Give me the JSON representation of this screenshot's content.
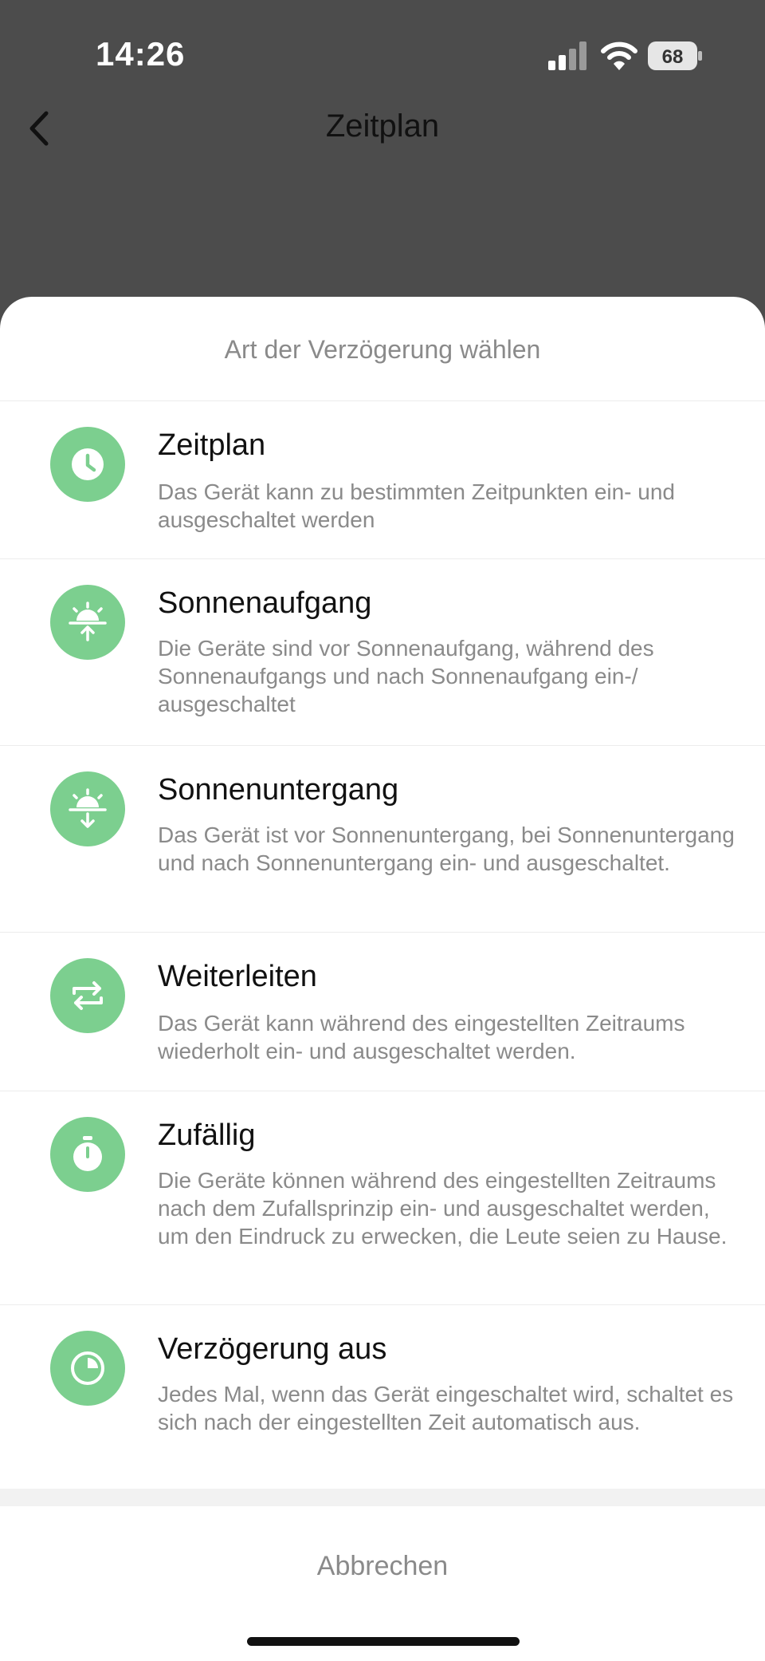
{
  "status": {
    "time": "14:26",
    "battery": "68"
  },
  "nav": {
    "title": "Zeitplan"
  },
  "sheet": {
    "title": "Art der Verzögerung wählen",
    "options": [
      {
        "icon": "clock-icon",
        "title": "Zeitplan",
        "desc": "Das Gerät kann zu bestimmten Zeitpunkten ein- und ausgeschaltet werden"
      },
      {
        "icon": "sunrise-icon",
        "title": "Sonnenaufgang",
        "desc": "Die Geräte sind vor Sonnenaufgang, während des Sonnenaufgangs und nach Sonnenaufgang ein-/ ausgeschaltet"
      },
      {
        "icon": "sunset-icon",
        "title": "Sonnenuntergang",
        "desc": "Das Gerät ist vor Sonnenuntergang, bei Sonnenuntergang und nach Sonnenuntergang ein- und ausgeschaltet."
      },
      {
        "icon": "repeat-icon",
        "title": "Weiterleiten",
        "desc": "Das Gerät kann während des eingestellten Zeitraums wiederholt ein- und ausgeschaltet werden."
      },
      {
        "icon": "stopwatch-icon",
        "title": "Zufällig",
        "desc": "Die Geräte können während des eingestellten Zeitraums nach dem Zufallsprinzip ein- und ausgeschaltet werden, um den Eindruck zu erwecken, die Leute seien zu Hause."
      },
      {
        "icon": "timer-off-icon",
        "title": "Verzögerung aus",
        "desc": "Jedes Mal, wenn das Gerät eingeschaltet wird, schaltet es sich nach der eingestellten Zeit automatisch aus."
      }
    ],
    "cancel": "Abbrechen"
  },
  "colors": {
    "accent": "#7ccf8f",
    "overlay": "#4c4c4c",
    "text": "#111111",
    "muted": "#8a8a8a"
  }
}
